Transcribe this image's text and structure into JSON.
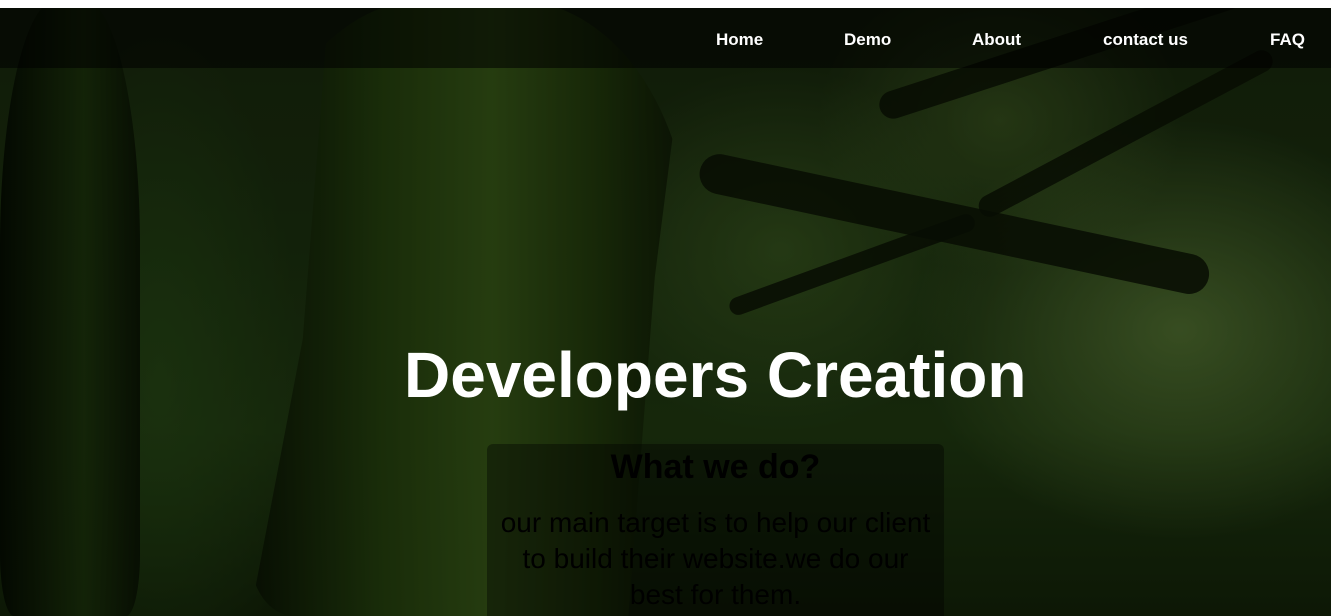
{
  "nav": {
    "items": [
      {
        "label": "Home"
      },
      {
        "label": "Demo"
      },
      {
        "label": "About"
      },
      {
        "label": "contact us"
      },
      {
        "label": "FAQ"
      }
    ]
  },
  "hero": {
    "title": "Developers Creation"
  },
  "about": {
    "heading": "What we do?",
    "text": "our main target is to help our client to build their website.we do our best for them."
  },
  "colors": {
    "nav_text": "#ffffff",
    "title_text": "#ffffff",
    "body_text": "#000000"
  }
}
